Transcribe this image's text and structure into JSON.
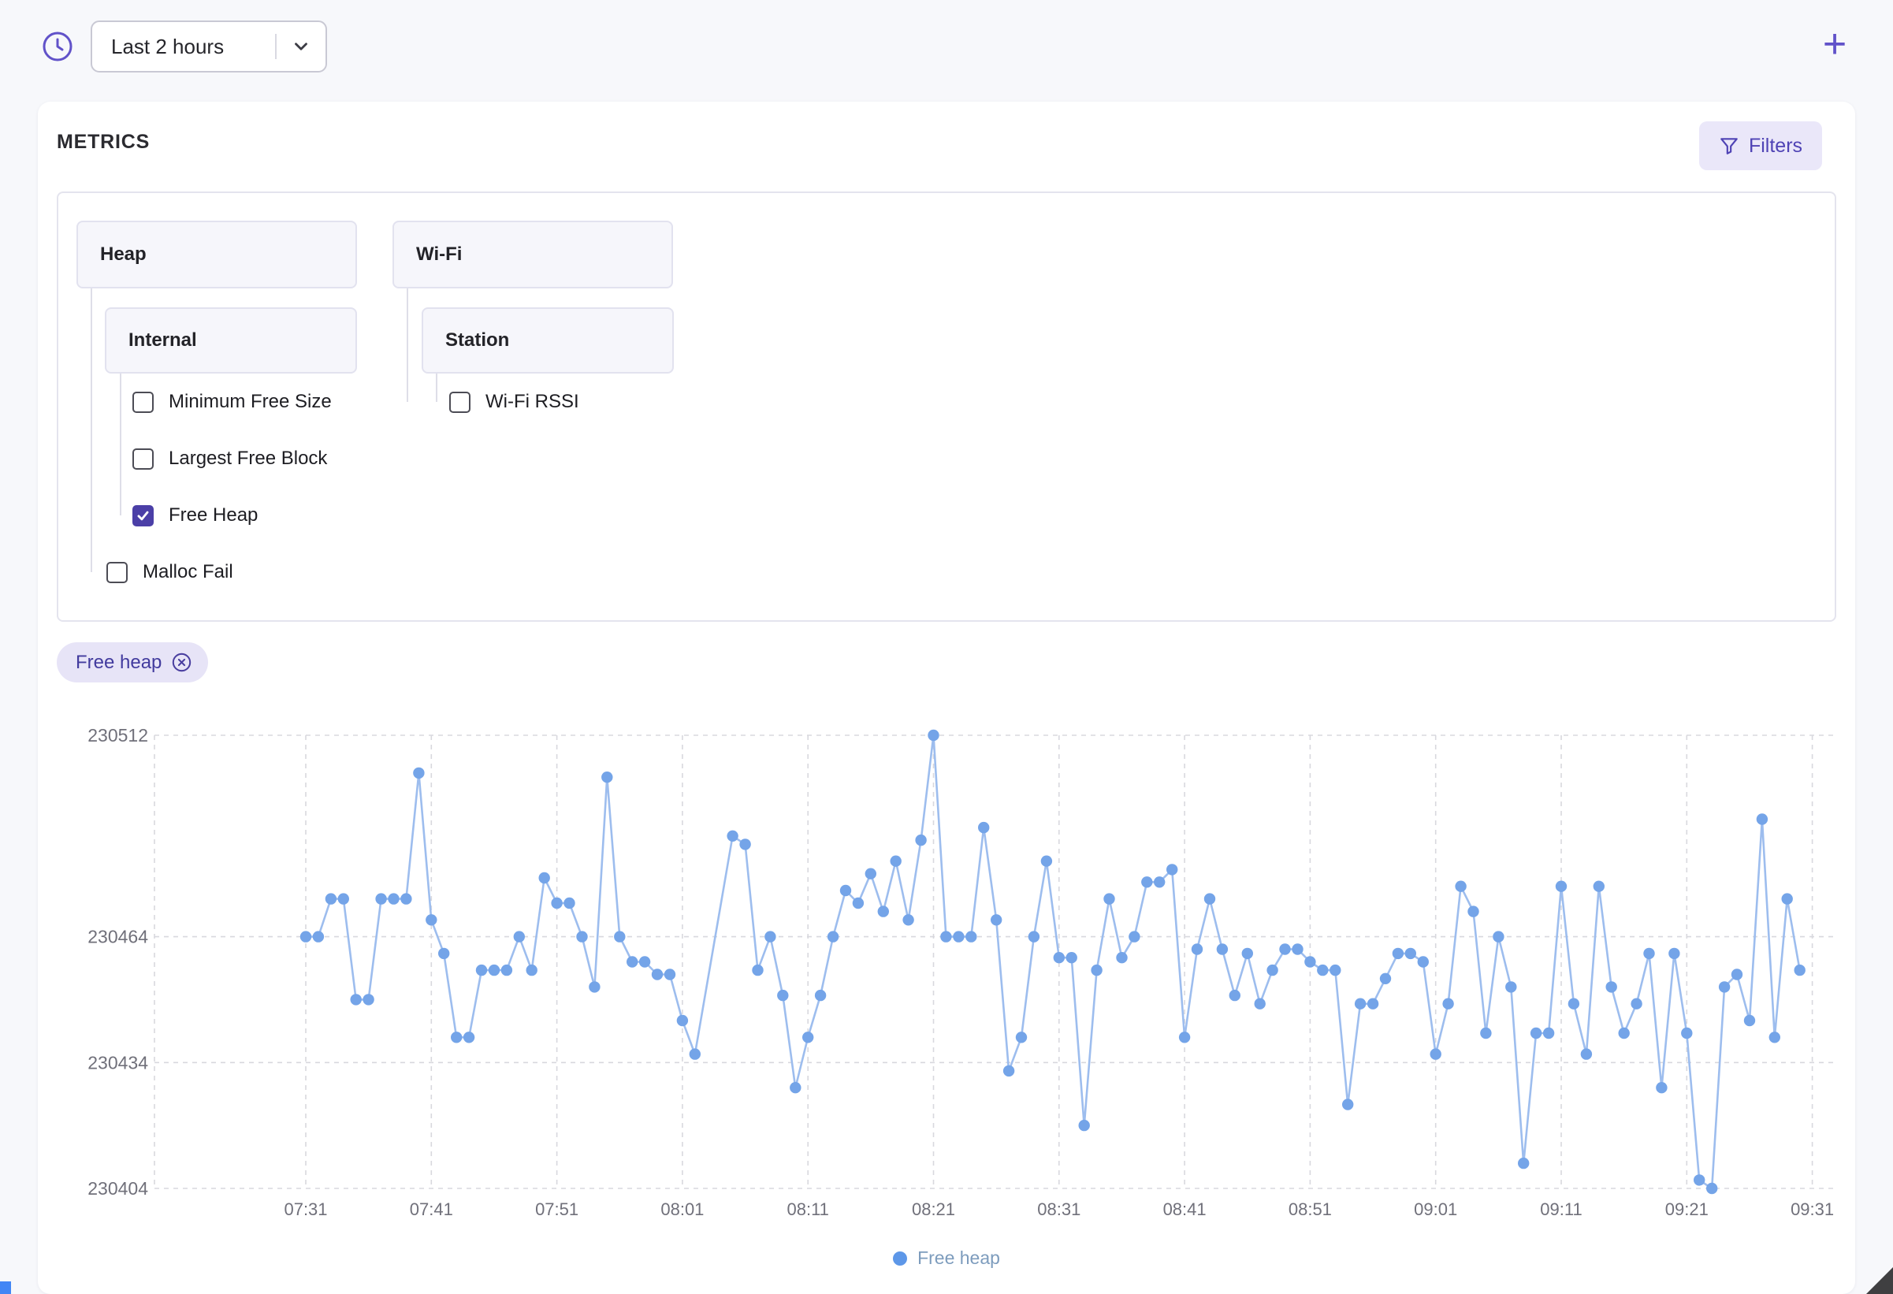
{
  "toolbar": {
    "time_range": "Last 2 hours",
    "add_label": "+"
  },
  "metrics_header": {
    "title": "METRICS",
    "filters_label": "Filters"
  },
  "tree": {
    "heap": "Heap",
    "wifi": "Wi-Fi",
    "internal": "Internal",
    "station": "Station",
    "min_free_size": "Minimum Free Size",
    "largest_free_block": "Largest Free Block",
    "free_heap": "Free Heap",
    "malloc_fail": "Malloc Fail",
    "wifi_rssi": "Wi-Fi RSSI",
    "checked": {
      "min_free_size": false,
      "largest_free_block": false,
      "free_heap": true,
      "malloc_fail": false,
      "wifi_rssi": false
    }
  },
  "chip": {
    "label": "Free heap"
  },
  "chart_data": {
    "type": "line",
    "title": "",
    "xlabel": "",
    "ylabel": "",
    "legend": "Free heap",
    "legend_position": "bottom",
    "grid": true,
    "y_ticks": [
      230512,
      230464,
      230434,
      230404
    ],
    "ylim": [
      230404,
      230512
    ],
    "x_tick_labels": [
      "07:31",
      "07:41",
      "07:51",
      "08:01",
      "08:11",
      "08:21",
      "08:31",
      "08:41",
      "08:51",
      "09:01",
      "09:11",
      "09:21",
      "09:31"
    ],
    "x_tick_interval_minutes": 10,
    "values_start_offset_minutes": 0,
    "x_step_minutes": 1,
    "values": [
      230464,
      230464,
      230473,
      230473,
      230449,
      230449,
      230473,
      230473,
      230473,
      230503,
      230468,
      230460,
      230440,
      230440,
      230456,
      230456,
      230456,
      230464,
      230456,
      230478,
      230472,
      230472,
      230464,
      230452,
      230502,
      230464,
      230458,
      230458,
      230455,
      230455,
      230444,
      230436,
      null,
      null,
      230488,
      230486,
      230456,
      230464,
      230450,
      230428,
      230440,
      230450,
      230464,
      230475,
      230472,
      230479,
      230470,
      230482,
      230468,
      230487,
      230512,
      230464,
      230464,
      230464,
      230490,
      230468,
      230432,
      230440,
      230464,
      230482,
      230459,
      230459,
      230419,
      230456,
      230473,
      230459,
      230464,
      230477,
      230477,
      230480,
      230440,
      230461,
      230473,
      230461,
      230450,
      230460,
      230448,
      230456,
      230461,
      230461,
      230458,
      230456,
      230456,
      230424,
      230448,
      230448,
      230454,
      230460,
      230460,
      230458,
      230436,
      230448,
      230476,
      230470,
      230441,
      230464,
      230452,
      230410,
      230441,
      230441,
      230476,
      230448,
      230436,
      230476,
      230452,
      230441,
      230448,
      230460,
      230428,
      230460,
      230441,
      230406,
      230404,
      230452,
      230455,
      230444,
      230492,
      230440,
      230473,
      230456
    ],
    "line_color": "#9dbdee",
    "point_color": "#74a4e8",
    "grid_color": "#d8d8de",
    "tick_color": "#70707a",
    "legend_dot_color": "#5d97e8",
    "legend_text_color": "#7d9cbd"
  },
  "colors": {
    "accent": "#6152c9",
    "checkbox_checked": "#4b3fa7"
  }
}
